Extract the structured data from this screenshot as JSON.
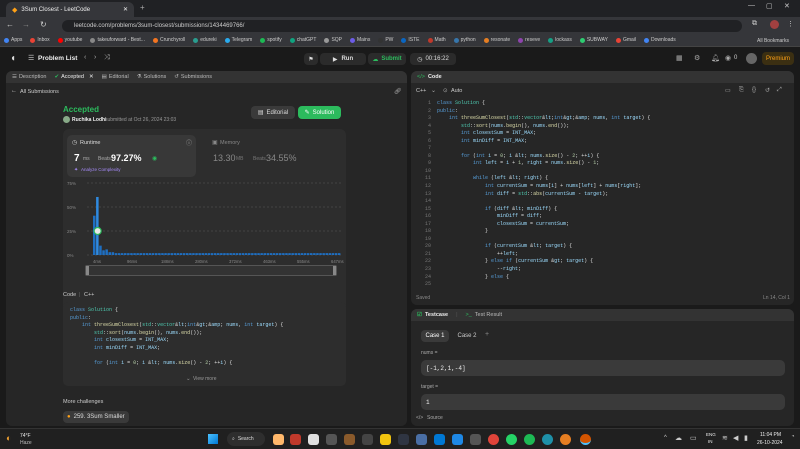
{
  "browser": {
    "tab_title": "3Sum Closest - LeetCode",
    "url": "leetcode.com/problems/3sum-closest/submissions/1434469766/",
    "bookmarks": [
      "Apps",
      "Inbox",
      "youtube",
      "takeuforward - Best...",
      "Crunchyroll",
      "edureki",
      "Telegram",
      "spotify",
      "chatGPT",
      "SQP",
      "Mains",
      "PW",
      "ISTE",
      "Math",
      "python",
      "resonate",
      "reseve",
      "lockass",
      "SUBWAY",
      "Gmail",
      "Downloads"
    ],
    "all_bookmarks": "All Bookmarks"
  },
  "topbar": {
    "problem_list": "Problem List",
    "run": "Run",
    "submit": "Submit",
    "timer": "00:16:22",
    "coins": "0",
    "premium": "Premium"
  },
  "left": {
    "tabs": [
      "Description",
      "Accepted",
      "Editorial",
      "Solutions",
      "Submissions"
    ],
    "all_submissions": "All Submissions",
    "status": "Accepted",
    "author": "Ruchika Lodhi",
    "submitted": "submitted at Oct 26, 2024 23:03",
    "editorial_btn": "Editorial",
    "solution_btn": "Solution",
    "runtime_label": "Runtime",
    "runtime_value": "7",
    "runtime_unit": "ms",
    "beats_label": "Beats",
    "runtime_beats": "97.27%",
    "analyze": "Analyze Complexity",
    "memory_label": "Memory",
    "memory_value": "13.30",
    "memory_unit": "MB",
    "memory_beats": "34.55%",
    "y_ticks": [
      "75%",
      "50%",
      "25%",
      "0%"
    ],
    "x_ticks": [
      "4ms",
      "96ms",
      "188ms",
      "280ms",
      "372ms",
      "463ms",
      "555ms",
      "647ms"
    ],
    "code_header": "Code",
    "code_lang": "C++",
    "view_more": "View more",
    "more_challenges": "More challenges",
    "challenge": "259. 3Sum Smaller"
  },
  "editor": {
    "title": "Code",
    "lang": "C++",
    "mode": "Auto",
    "saved": "Saved",
    "cursor": "Ln 14, Col 1",
    "lines": [
      "class Solution {",
      "public:",
      "    int threeSumClosest(std::vector<int>& nums, int target) {",
      "        std::sort(nums.begin(), nums.end());",
      "        int closestSum = INT_MAX;",
      "        int minDiff = INT_MAX;",
      "",
      "        for (int i = 0; i < nums.size() - 2; ++i) {",
      "            int left = i + 1, right = nums.size() - 1;",
      "",
      "            while (left < right) {",
      "                int currentSum = nums[i] + nums[left] + nums[right];",
      "                int diff = std::abs(currentSum - target);",
      "",
      "                if (diff < minDiff) {",
      "                    minDiff = diff;",
      "                    closestSum = currentSum;",
      "                }",
      "",
      "                if (currentSum < target) {",
      "                    ++left;",
      "                } else if (currentSum > target) {",
      "                    --right;",
      "                } else {",
      "                    "
    ],
    "line_numbers": [
      "1",
      "2",
      "3",
      "4",
      "5",
      "6",
      "7",
      "8",
      "9",
      "10",
      "11",
      "12",
      "13",
      "14",
      "15",
      "16",
      "17",
      "18",
      "19",
      "20",
      "21",
      "22",
      "23",
      "24",
      "25"
    ]
  },
  "testcase": {
    "tab": "Testcase",
    "result_tab": "Test Result",
    "cases": [
      "Case 1",
      "Case 2"
    ],
    "nums_label": "nums =",
    "nums_value": "[-1,2,1,-4]",
    "target_label": "target =",
    "target_value": "1",
    "source": "Source"
  },
  "snippet": [
    "class Solution {",
    "public:",
    "    int threeSumClosest(std::vector<int>& nums, int target) {",
    "        std::sort(nums.begin(), nums.end());",
    "        int closestSum = INT_MAX;",
    "        int minDiff = INT_MAX;",
    "",
    "        for (int i = 0; i < nums.size() - 2; ++i) {"
  ],
  "taskbar": {
    "weather_temp": "74°F",
    "weather_desc": "Haze",
    "search": "Search",
    "lang1": "ENG",
    "lang2": "IN",
    "time": "11:04 PM",
    "date": "26-10-2024"
  },
  "colors": {
    "accepted": "#2cbb5d",
    "accent": "#ffa116",
    "bar": "#1e88e5"
  }
}
